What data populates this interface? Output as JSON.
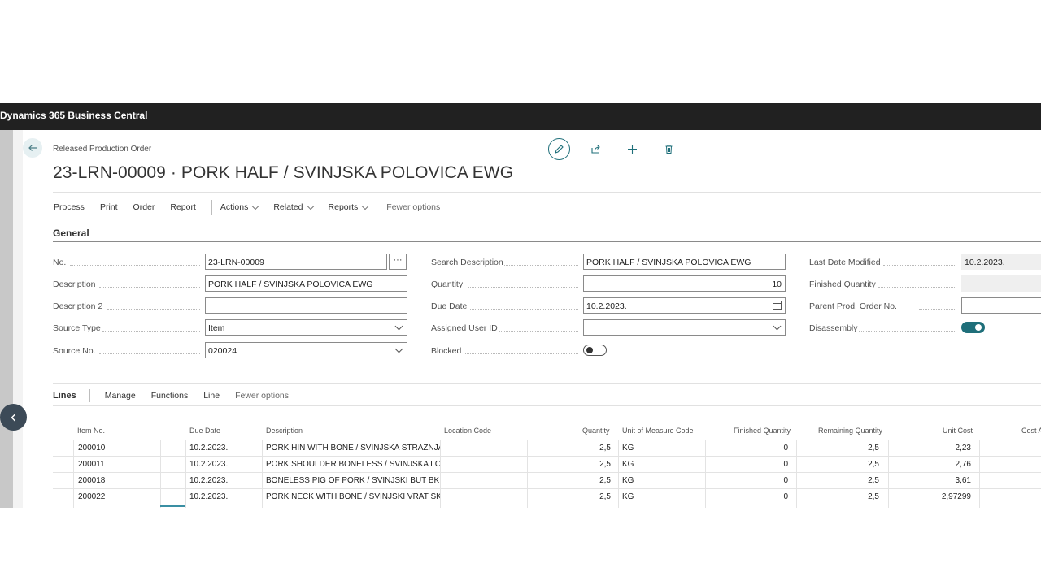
{
  "app": {
    "title": "Dynamics 365 Business Central"
  },
  "page": {
    "caption": "Released Production Order",
    "title": "23-LRN-00009 · PORK HALF / SVINJSKA POLOVICA EWG"
  },
  "title_actions": {
    "icons": [
      "edit-icon",
      "share-icon",
      "add-icon",
      "delete-icon"
    ]
  },
  "action_bar": {
    "process": "Process",
    "print": "Print",
    "order": "Order",
    "report": "Report",
    "actions": "Actions",
    "related": "Related",
    "reports": "Reports",
    "fewer": "Fewer options"
  },
  "general": {
    "title": "General",
    "no": {
      "label": "No.",
      "value": "23-LRN-00009"
    },
    "description": {
      "label": "Description",
      "value": "PORK HALF / SVINJSKA POLOVICA EWG"
    },
    "description2": {
      "label": "Description 2",
      "value": ""
    },
    "source_type": {
      "label": "Source Type",
      "value": "Item"
    },
    "source_no": {
      "label": "Source No.",
      "value": "020024"
    },
    "search_description": {
      "label": "Search Description",
      "value": "PORK HALF / SVINJSKA POLOVICA EWG"
    },
    "quantity": {
      "label": "Quantity",
      "value": "10"
    },
    "due_date": {
      "label": "Due Date",
      "value": "10.2.2023."
    },
    "assigned_user": {
      "label": "Assigned User ID",
      "value": ""
    },
    "blocked": {
      "label": "Blocked",
      "on": false
    },
    "last_date_modified": {
      "label": "Last Date Modified",
      "value": "10.2.2023."
    },
    "finished_quantity": {
      "label": "Finished Quantity",
      "value": ""
    },
    "parent_prod_order": {
      "label": "Parent Prod. Order No.",
      "value": ""
    },
    "disassembly": {
      "label": "Disassembly",
      "on": true
    }
  },
  "lines": {
    "title": "Lines",
    "manage": "Manage",
    "functions": "Functions",
    "line": "Line",
    "fewer": "Fewer options",
    "columns": [
      "Item No.",
      "Due Date",
      "Description",
      "Location Code",
      "Quantity",
      "Unit of Measure Code",
      "Finished Quantity",
      "Remaining Quantity",
      "Unit Cost",
      "Cost A"
    ],
    "rows": [
      {
        "item_no": "200010",
        "due_date": "10.2.2023.",
        "description": "PORK HIN WITH BONE / SVINJSKA STRAŽNJA...",
        "location": "",
        "quantity": "2,5",
        "uom": "KG",
        "finished": "0",
        "remaining": "2,5",
        "unit_cost": "2,23"
      },
      {
        "item_no": "200011",
        "due_date": "10.2.2023.",
        "description": "PORK SHOULDER BONELESS / SVINJSKA LOPA...",
        "location": "",
        "quantity": "2,5",
        "uom": "KG",
        "finished": "0",
        "remaining": "2,5",
        "unit_cost": "2,76"
      },
      {
        "item_no": "200018",
        "due_date": "10.2.2023.",
        "description": "BONELESS PIG OF PORK / SVINJSKI BUT BK",
        "location": "",
        "quantity": "2,5",
        "uom": "KG",
        "finished": "0",
        "remaining": "2,5",
        "unit_cost": "3,61"
      },
      {
        "item_no": "200022",
        "due_date": "10.2.2023.",
        "description": "PORK NECK WITH BONE / SVINJSKI VRAT SK",
        "location": "",
        "quantity": "2,5",
        "uom": "KG",
        "finished": "0",
        "remaining": "2,5",
        "unit_cost": "2,97299"
      }
    ]
  }
}
